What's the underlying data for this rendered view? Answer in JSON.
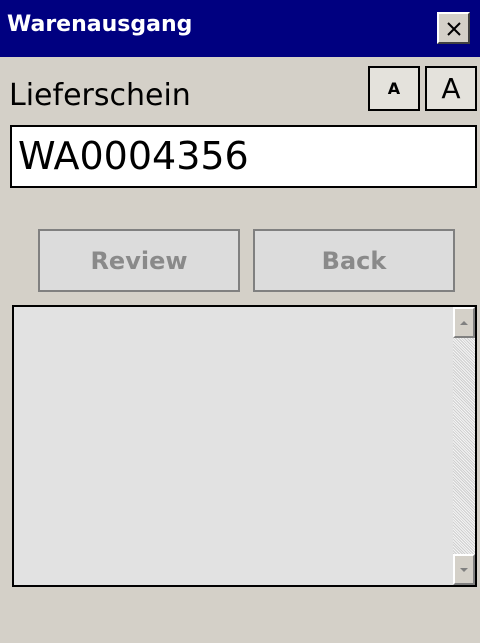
{
  "window": {
    "title": "Warenausgang",
    "close_icon": "close-icon"
  },
  "form": {
    "field_label": "Lieferschein",
    "field_value": "WA0004356",
    "font_small_label": "A",
    "font_large_label": "A"
  },
  "buttons": {
    "review_label": "Review",
    "back_label": "Back"
  },
  "colors": {
    "titlebar": "#000080",
    "background": "#d4d0c8",
    "disabled_text": "#8a8a8a"
  }
}
